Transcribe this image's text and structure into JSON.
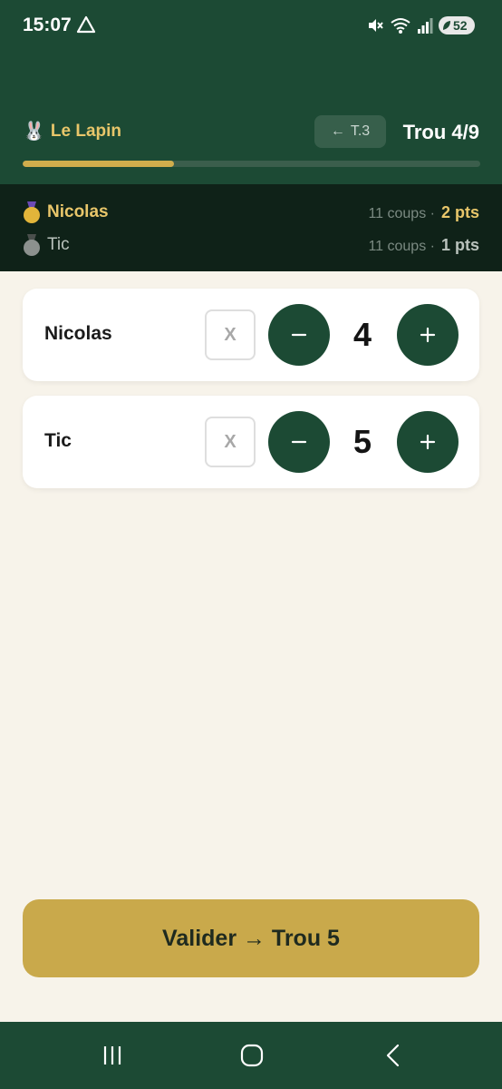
{
  "status_bar": {
    "time": "15:07",
    "battery": "52",
    "icons": [
      "alert-triangle-icon",
      "mute-icon",
      "wifi-icon",
      "signal-icon",
      "battery-icon"
    ]
  },
  "header": {
    "course_icon": "🐰",
    "course_name": "Le Lapin",
    "prev_arrow": "←",
    "prev_label": "T.3",
    "hole_label": "Trou 4/9",
    "progress": 0.33
  },
  "leaderboard": [
    {
      "name": "Nicolas",
      "strokes": "11 coups ·",
      "points": "2 pts",
      "medal": "gold"
    },
    {
      "name": "Tic",
      "strokes": "11 coups ·",
      "points": "1 pts",
      "medal": "silver"
    }
  ],
  "players": [
    {
      "name": "Nicolas",
      "x_label": "X",
      "score": "4"
    },
    {
      "name": "Tic",
      "x_label": "X",
      "score": "5"
    }
  ],
  "validate_label": "Valider → Trou 5",
  "colors": {
    "primary_green": "#1c4a34",
    "gold": "#c9a94b",
    "gold_text": "#e8c66a",
    "background": "#f7f3ea"
  }
}
